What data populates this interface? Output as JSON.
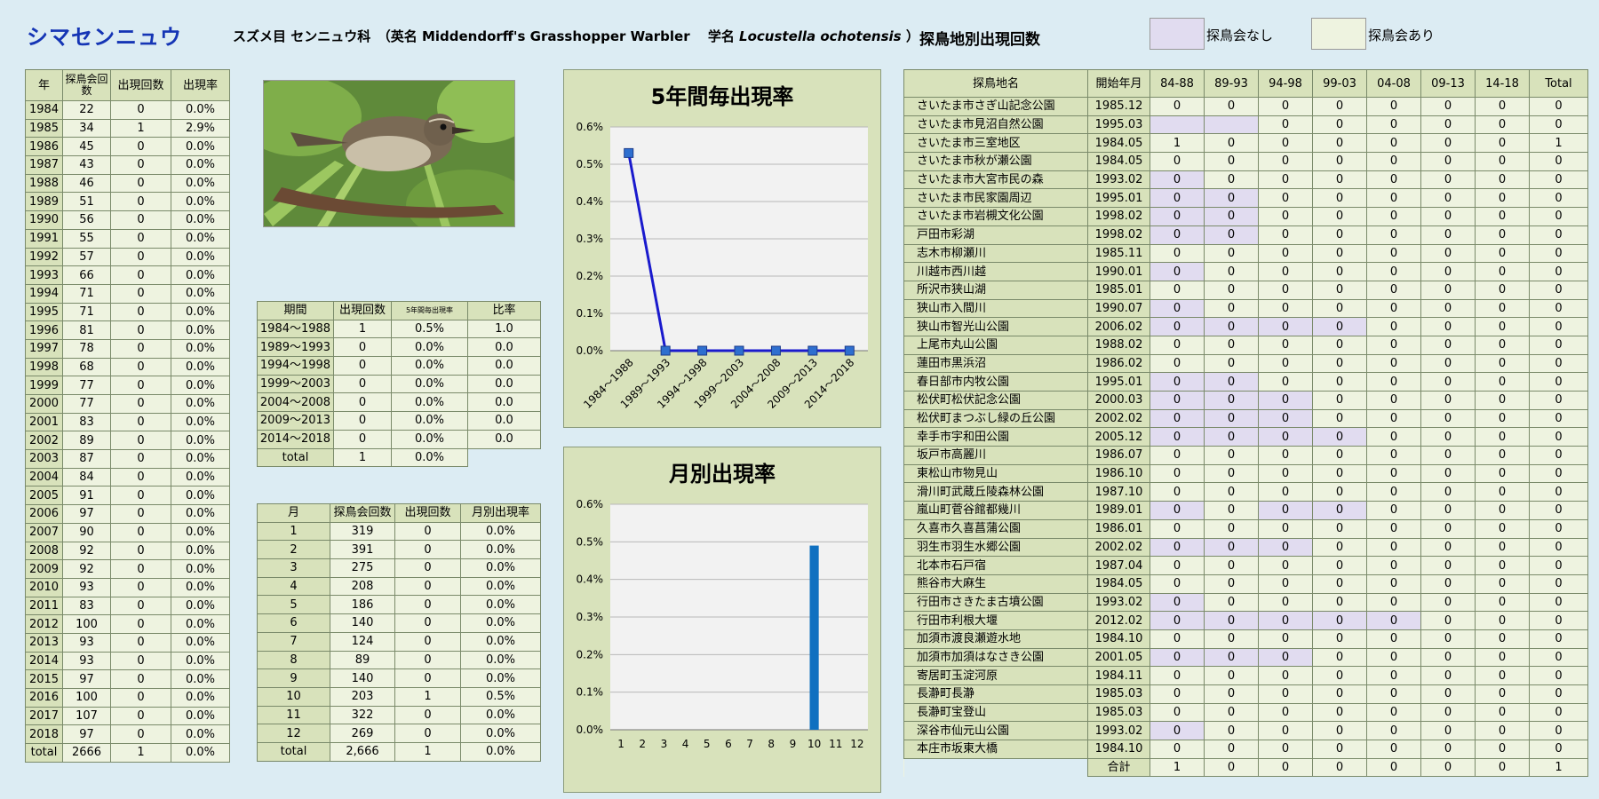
{
  "header": {
    "species_jp": "シマセンニュウ",
    "info_prefix": "スズメ目 センニュウ科　（英名 Middendorff's Grasshopper Warbler　 学名 ",
    "sci_name": "Locustella ochotensis",
    "info_suffix": " ）",
    "site_title": "探鳥地別出現回数",
    "legend_none": "探鳥会なし",
    "legend_yes": "探鳥会あり",
    "legend_none_color": "#e1dcf0",
    "legend_yes_color": "#eef3e0"
  },
  "yearly": {
    "headers": [
      "年",
      "探鳥会回数",
      "出現回数",
      "出現率"
    ],
    "rows": [
      [
        "1984",
        "22",
        "0",
        "0.0%"
      ],
      [
        "1985",
        "34",
        "1",
        "2.9%"
      ],
      [
        "1986",
        "45",
        "0",
        "0.0%"
      ],
      [
        "1987",
        "43",
        "0",
        "0.0%"
      ],
      [
        "1988",
        "46",
        "0",
        "0.0%"
      ],
      [
        "1989",
        "51",
        "0",
        "0.0%"
      ],
      [
        "1990",
        "56",
        "0",
        "0.0%"
      ],
      [
        "1991",
        "55",
        "0",
        "0.0%"
      ],
      [
        "1992",
        "57",
        "0",
        "0.0%"
      ],
      [
        "1993",
        "66",
        "0",
        "0.0%"
      ],
      [
        "1994",
        "71",
        "0",
        "0.0%"
      ],
      [
        "1995",
        "71",
        "0",
        "0.0%"
      ],
      [
        "1996",
        "81",
        "0",
        "0.0%"
      ],
      [
        "1997",
        "78",
        "0",
        "0.0%"
      ],
      [
        "1998",
        "68",
        "0",
        "0.0%"
      ],
      [
        "1999",
        "77",
        "0",
        "0.0%"
      ],
      [
        "2000",
        "77",
        "0",
        "0.0%"
      ],
      [
        "2001",
        "83",
        "0",
        "0.0%"
      ],
      [
        "2002",
        "89",
        "0",
        "0.0%"
      ],
      [
        "2003",
        "87",
        "0",
        "0.0%"
      ],
      [
        "2004",
        "84",
        "0",
        "0.0%"
      ],
      [
        "2005",
        "91",
        "0",
        "0.0%"
      ],
      [
        "2006",
        "97",
        "0",
        "0.0%"
      ],
      [
        "2007",
        "90",
        "0",
        "0.0%"
      ],
      [
        "2008",
        "92",
        "0",
        "0.0%"
      ],
      [
        "2009",
        "92",
        "0",
        "0.0%"
      ],
      [
        "2010",
        "93",
        "0",
        "0.0%"
      ],
      [
        "2011",
        "83",
        "0",
        "0.0%"
      ],
      [
        "2012",
        "100",
        "0",
        "0.0%"
      ],
      [
        "2013",
        "93",
        "0",
        "0.0%"
      ],
      [
        "2014",
        "93",
        "0",
        "0.0%"
      ],
      [
        "2015",
        "97",
        "0",
        "0.0%"
      ],
      [
        "2016",
        "100",
        "0",
        "0.0%"
      ],
      [
        "2017",
        "107",
        "0",
        "0.0%"
      ],
      [
        "2018",
        "97",
        "0",
        "0.0%"
      ]
    ],
    "total": [
      "total",
      "2666",
      "1",
      "0.0%"
    ]
  },
  "period": {
    "headers": [
      "期間",
      "出現回数",
      "5年間毎出現率",
      "比率"
    ],
    "rows": [
      [
        "1984～1988",
        "1",
        "0.5%",
        "1.0"
      ],
      [
        "1989～1993",
        "0",
        "0.0%",
        "0.0"
      ],
      [
        "1994～1998",
        "0",
        "0.0%",
        "0.0"
      ],
      [
        "1999～2003",
        "0",
        "0.0%",
        "0.0"
      ],
      [
        "2004～2008",
        "0",
        "0.0%",
        "0.0"
      ],
      [
        "2009～2013",
        "0",
        "0.0%",
        "0.0"
      ],
      [
        "2014～2018",
        "0",
        "0.0%",
        "0.0"
      ]
    ],
    "total": [
      "total",
      "1",
      "0.0%"
    ]
  },
  "monthly": {
    "headers": [
      "月",
      "探鳥会回数",
      "出現回数",
      "月別出現率"
    ],
    "rows": [
      [
        "1",
        "319",
        "0",
        "0.0%"
      ],
      [
        "2",
        "391",
        "0",
        "0.0%"
      ],
      [
        "3",
        "275",
        "0",
        "0.0%"
      ],
      [
        "4",
        "208",
        "0",
        "0.0%"
      ],
      [
        "5",
        "186",
        "0",
        "0.0%"
      ],
      [
        "6",
        "140",
        "0",
        "0.0%"
      ],
      [
        "7",
        "124",
        "0",
        "0.0%"
      ],
      [
        "8",
        "89",
        "0",
        "0.0%"
      ],
      [
        "9",
        "140",
        "0",
        "0.0%"
      ],
      [
        "10",
        "203",
        "1",
        "0.5%"
      ],
      [
        "11",
        "322",
        "0",
        "0.0%"
      ],
      [
        "12",
        "269",
        "0",
        "0.0%"
      ]
    ],
    "total": [
      "total",
      "2,666",
      "1",
      "0.0%"
    ]
  },
  "sites": {
    "headers": [
      "探鳥地名",
      "開始年月",
      "84-88",
      "89-93",
      "94-98",
      "99-03",
      "04-08",
      "09-13",
      "14-18",
      "Total"
    ],
    "rows": [
      {
        "name": "さいたま市さぎ山記念公園",
        "start": "1985.12",
        "vals": [
          "0",
          "0",
          "0",
          "0",
          "0",
          "0",
          "0"
        ],
        "total": "0",
        "none": []
      },
      {
        "name": "さいたま市見沼自然公園",
        "start": "1995.03",
        "vals": [
          "",
          "",
          "0",
          "0",
          "0",
          "0",
          "0"
        ],
        "total": "0",
        "none": [
          0,
          1
        ]
      },
      {
        "name": "さいたま市三室地区",
        "start": "1984.05",
        "vals": [
          "1",
          "0",
          "0",
          "0",
          "0",
          "0",
          "0"
        ],
        "total": "1",
        "none": []
      },
      {
        "name": "さいたま市秋が瀬公園",
        "start": "1984.05",
        "vals": [
          "0",
          "0",
          "0",
          "0",
          "0",
          "0",
          "0"
        ],
        "total": "0",
        "none": []
      },
      {
        "name": "さいたま市大宮市民の森",
        "start": "1993.02",
        "vals": [
          "0",
          "0",
          "0",
          "0",
          "0",
          "0",
          "0"
        ],
        "total": "0",
        "none": [
          0
        ]
      },
      {
        "name": "さいたま市民家園周辺",
        "start": "1995.01",
        "vals": [
          "0",
          "0",
          "0",
          "0",
          "0",
          "0",
          "0"
        ],
        "total": "0",
        "none": [
          0,
          1
        ]
      },
      {
        "name": "さいたま市岩槻文化公園",
        "start": "1998.02",
        "vals": [
          "0",
          "0",
          "0",
          "0",
          "0",
          "0",
          "0"
        ],
        "total": "0",
        "none": [
          0,
          1
        ]
      },
      {
        "name": "戸田市彩湖",
        "start": "1998.02",
        "vals": [
          "0",
          "0",
          "0",
          "0",
          "0",
          "0",
          "0"
        ],
        "total": "0",
        "none": [
          0,
          1
        ]
      },
      {
        "name": "志木市柳瀬川",
        "start": "1985.11",
        "vals": [
          "0",
          "0",
          "0",
          "0",
          "0",
          "0",
          "0"
        ],
        "total": "0",
        "none": []
      },
      {
        "name": "川越市西川越",
        "start": "1990.01",
        "vals": [
          "0",
          "0",
          "0",
          "0",
          "0",
          "0",
          "0"
        ],
        "total": "0",
        "none": [
          0
        ]
      },
      {
        "name": "所沢市狭山湖",
        "start": "1985.01",
        "vals": [
          "0",
          "0",
          "0",
          "0",
          "0",
          "0",
          "0"
        ],
        "total": "0",
        "none": []
      },
      {
        "name": "狭山市入間川",
        "start": "1990.07",
        "vals": [
          "0",
          "0",
          "0",
          "0",
          "0",
          "0",
          "0"
        ],
        "total": "0",
        "none": [
          0
        ]
      },
      {
        "name": "狭山市智光山公園",
        "start": "2006.02",
        "vals": [
          "0",
          "0",
          "0",
          "0",
          "0",
          "0",
          "0"
        ],
        "total": "0",
        "none": [
          0,
          1,
          2,
          3
        ]
      },
      {
        "name": "上尾市丸山公園",
        "start": "1988.02",
        "vals": [
          "0",
          "0",
          "0",
          "0",
          "0",
          "0",
          "0"
        ],
        "total": "0",
        "none": []
      },
      {
        "name": "蓮田市黒浜沼",
        "start": "1986.02",
        "vals": [
          "0",
          "0",
          "0",
          "0",
          "0",
          "0",
          "0"
        ],
        "total": "0",
        "none": []
      },
      {
        "name": "春日部市内牧公園",
        "start": "1995.01",
        "vals": [
          "0",
          "0",
          "0",
          "0",
          "0",
          "0",
          "0"
        ],
        "total": "0",
        "none": [
          0,
          1
        ]
      },
      {
        "name": "松伏町松伏記念公園",
        "start": "2000.03",
        "vals": [
          "0",
          "0",
          "0",
          "0",
          "0",
          "0",
          "0"
        ],
        "total": "0",
        "none": [
          0,
          1,
          2
        ]
      },
      {
        "name": "松伏町まつぶし緑の丘公園",
        "start": "2002.02",
        "vals": [
          "0",
          "0",
          "0",
          "0",
          "0",
          "0",
          "0"
        ],
        "total": "0",
        "none": [
          0,
          1,
          2
        ]
      },
      {
        "name": "幸手市宇和田公園",
        "start": "2005.12",
        "vals": [
          "0",
          "0",
          "0",
          "0",
          "0",
          "0",
          "0"
        ],
        "total": "0",
        "none": [
          0,
          1,
          2,
          3
        ]
      },
      {
        "name": "坂戸市高麗川",
        "start": "1986.07",
        "vals": [
          "0",
          "0",
          "0",
          "0",
          "0",
          "0",
          "0"
        ],
        "total": "0",
        "none": []
      },
      {
        "name": "東松山市物見山",
        "start": "1986.10",
        "vals": [
          "0",
          "0",
          "0",
          "0",
          "0",
          "0",
          "0"
        ],
        "total": "0",
        "none": []
      },
      {
        "name": "滑川町武蔵丘陵森林公園",
        "start": "1987.10",
        "vals": [
          "0",
          "0",
          "0",
          "0",
          "0",
          "0",
          "0"
        ],
        "total": "0",
        "none": []
      },
      {
        "name": "嵐山町菅谷館都幾川",
        "start": "1989.01",
        "vals": [
          "0",
          "0",
          "0",
          "0",
          "0",
          "0",
          "0"
        ],
        "total": "0",
        "none": [
          0,
          2,
          3
        ]
      },
      {
        "name": "久喜市久喜菖蒲公園",
        "start": "1986.01",
        "vals": [
          "0",
          "0",
          "0",
          "0",
          "0",
          "0",
          "0"
        ],
        "total": "0",
        "none": []
      },
      {
        "name": "羽生市羽生水郷公園",
        "start": "2002.02",
        "vals": [
          "0",
          "0",
          "0",
          "0",
          "0",
          "0",
          "0"
        ],
        "total": "0",
        "none": [
          0,
          1,
          2
        ]
      },
      {
        "name": "北本市石戸宿",
        "start": "1987.04",
        "vals": [
          "0",
          "0",
          "0",
          "0",
          "0",
          "0",
          "0"
        ],
        "total": "0",
        "none": []
      },
      {
        "name": "熊谷市大麻生",
        "start": "1984.05",
        "vals": [
          "0",
          "0",
          "0",
          "0",
          "0",
          "0",
          "0"
        ],
        "total": "0",
        "none": []
      },
      {
        "name": "行田市さきたま古墳公園",
        "start": "1993.02",
        "vals": [
          "0",
          "0",
          "0",
          "0",
          "0",
          "0",
          "0"
        ],
        "total": "0",
        "none": [
          0
        ]
      },
      {
        "name": "行田市利根大堰",
        "start": "2012.02",
        "vals": [
          "0",
          "0",
          "0",
          "0",
          "0",
          "0",
          "0"
        ],
        "total": "0",
        "none": [
          0,
          1,
          2,
          3,
          4
        ]
      },
      {
        "name": "加須市渡良瀬遊水地",
        "start": "1984.10",
        "vals": [
          "0",
          "0",
          "0",
          "0",
          "0",
          "0",
          "0"
        ],
        "total": "0",
        "none": []
      },
      {
        "name": "加須市加須はなさき公園",
        "start": "2001.05",
        "vals": [
          "0",
          "0",
          "0",
          "0",
          "0",
          "0",
          "0"
        ],
        "total": "0",
        "none": [
          0,
          1,
          2
        ]
      },
      {
        "name": "寄居町玉淀河原",
        "start": "1984.11",
        "vals": [
          "0",
          "0",
          "0",
          "0",
          "0",
          "0",
          "0"
        ],
        "total": "0",
        "none": []
      },
      {
        "name": "長瀞町長瀞",
        "start": "1985.03",
        "vals": [
          "0",
          "0",
          "0",
          "0",
          "0",
          "0",
          "0"
        ],
        "total": "0",
        "none": []
      },
      {
        "name": "長瀞町宝登山",
        "start": "1985.03",
        "vals": [
          "0",
          "0",
          "0",
          "0",
          "0",
          "0",
          "0"
        ],
        "total": "0",
        "none": []
      },
      {
        "name": "深谷市仙元山公園",
        "start": "1993.02",
        "vals": [
          "0",
          "0",
          "0",
          "0",
          "0",
          "0",
          "0"
        ],
        "total": "0",
        "none": [
          0
        ]
      },
      {
        "name": "本庄市坂東大橋",
        "start": "1984.10",
        "vals": [
          "0",
          "0",
          "0",
          "0",
          "0",
          "0",
          "0"
        ],
        "total": "0",
        "none": []
      }
    ],
    "total_label": "合計",
    "totals": [
      "1",
      "0",
      "0",
      "0",
      "0",
      "0",
      "0",
      "1"
    ]
  },
  "chart_data": [
    {
      "type": "line",
      "title": "5年間毎出現率",
      "categories": [
        "1984～1988",
        "1989～1993",
        "1994～1998",
        "1999～2003",
        "2004～2008",
        "2009～2013",
        "2014～2018"
      ],
      "values": [
        0.0053,
        0,
        0,
        0,
        0,
        0,
        0
      ],
      "ylim": [
        0,
        0.006
      ],
      "yticks": [
        "0.0%",
        "0.1%",
        "0.2%",
        "0.3%",
        "0.4%",
        "0.5%",
        "0.6%"
      ],
      "color": "#1a1acd",
      "marker_color": "#2e6fcf",
      "grid": true
    },
    {
      "type": "bar",
      "title": "月別出現率",
      "categories": [
        "1",
        "2",
        "3",
        "4",
        "5",
        "6",
        "7",
        "8",
        "9",
        "10",
        "11",
        "12"
      ],
      "values": [
        0,
        0,
        0,
        0,
        0,
        0,
        0,
        0,
        0,
        0.0049,
        0,
        0
      ],
      "ylim": [
        0,
        0.006
      ],
      "yticks": [
        "0.0%",
        "0.1%",
        "0.2%",
        "0.3%",
        "0.4%",
        "0.5%",
        "0.6%"
      ],
      "color": "#1070c0",
      "grid": true
    }
  ]
}
